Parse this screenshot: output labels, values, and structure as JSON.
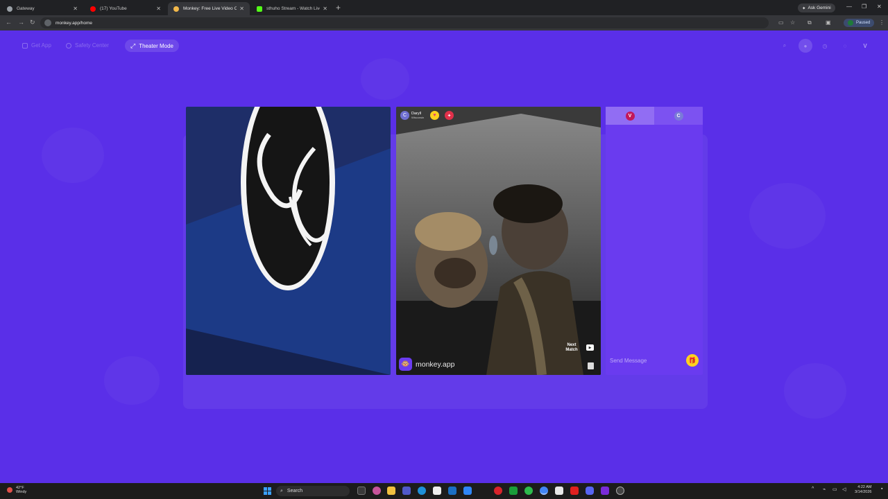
{
  "browser": {
    "tabs": [
      {
        "label": "Gateway",
        "color": "#9aa0a6",
        "active": false
      },
      {
        "label": "(17) YouTube",
        "color": "#ff0000",
        "active": false
      },
      {
        "label": "Monkey: Free Live Video C",
        "color": "#f2b84b",
        "active": true
      },
      {
        "label": "sthuho Stream - Watch Live on",
        "color": "#53fc18",
        "active": false
      }
    ],
    "new_tab": "+",
    "gemini_label": "Ask Gemini",
    "url": "monkey.app/home",
    "profile_status": "Paused",
    "profile_initial": "V"
  },
  "site": {
    "nav": {
      "get_app": "Get App",
      "safety_center": "Safety Center",
      "theater_mode": "Theater Mode"
    },
    "header_icons": [
      "search-icon",
      "coin-icon",
      "clock-icon",
      "chat-icon"
    ],
    "user_initial": "V",
    "peer": {
      "initial": "C",
      "name": "Daryll",
      "location": "Wisconsin"
    },
    "next_match": "Next Match",
    "brand": "monkey.app",
    "chat": {
      "tab_me_initial": "V",
      "tab_peer_initial": "C",
      "placeholder": "Send Message"
    }
  },
  "taskbar": {
    "weather_temp": "42°F",
    "weather_desc": "Windy",
    "search_label": "Search",
    "time": "4:22 AM",
    "date": "3/14/2026"
  },
  "colors": {
    "page_bg": "#5a2fe8",
    "chat_bg": "#6a3bef",
    "gift": "#ffd21e"
  }
}
